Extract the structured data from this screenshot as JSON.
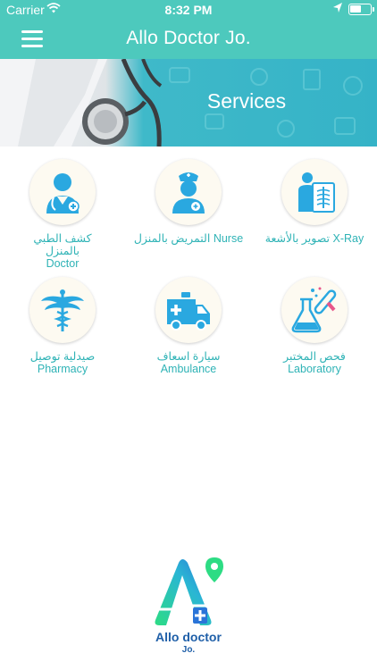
{
  "status_bar": {
    "carrier": "Carrier",
    "time": "8:32 PM"
  },
  "header": {
    "title": "Allo Doctor Jo."
  },
  "banner": {
    "title": "Services"
  },
  "services": [
    {
      "label": "كشف الطبي بالمنزل Doctor",
      "icon": "doctor-icon"
    },
    {
      "label": "التمريض بالمنزل Nurse",
      "icon": "nurse-icon"
    },
    {
      "label": "تصوير بالأشعة X-Ray",
      "icon": "xray-icon"
    },
    {
      "label": "صيدلية توصيل Pharmacy",
      "icon": "pharmacy-icon"
    },
    {
      "label": "سيارة اسعاف Ambulance",
      "icon": "ambulance-icon"
    },
    {
      "label": "فحص المختبر Laboratory",
      "icon": "laboratory-icon"
    }
  ],
  "footer_logo": {
    "brand": "Allo doctor",
    "sub": "Jo."
  },
  "colors": {
    "header": "#4dc9bd",
    "label": "#2fb3b6",
    "icon_blue": "#2aa8e0",
    "logo_blue": "#1f5fa8"
  }
}
